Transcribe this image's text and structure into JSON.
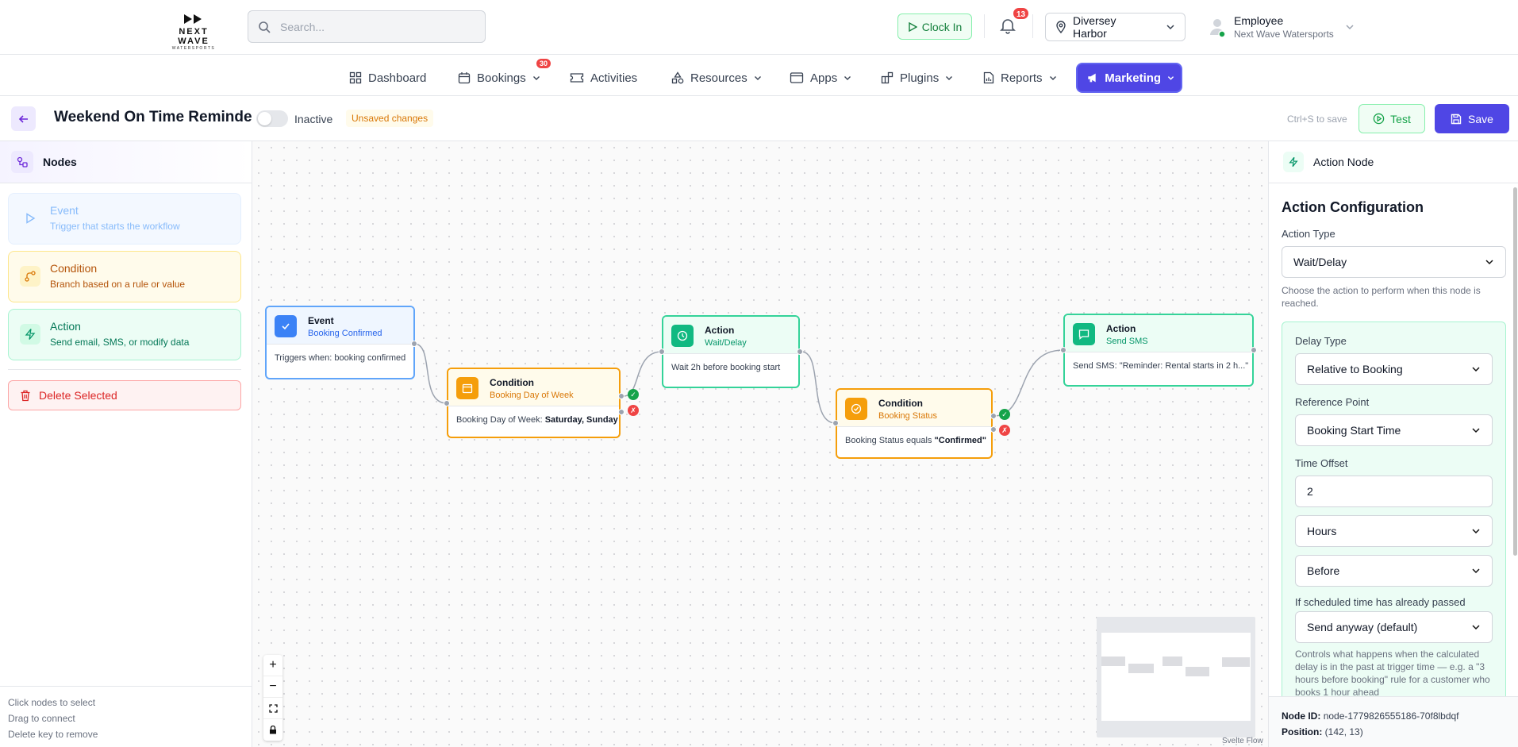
{
  "brand": {
    "name": "NEXT WAVE",
    "tagline": "WATERSPORTS"
  },
  "search": {
    "placeholder": "Search..."
  },
  "header": {
    "clock_in_label": "Clock In",
    "notifications_count": "13",
    "location": "Diversey Harbor",
    "user_role": "Employee",
    "user_org": "Next Wave Watersports"
  },
  "nav": {
    "dashboard": "Dashboard",
    "bookings": "Bookings",
    "bookings_badge": "30",
    "activities": "Activities",
    "resources": "Resources",
    "apps": "Apps",
    "plugins": "Plugins",
    "reports": "Reports",
    "marketing": "Marketing",
    "active_color": "#4f46e5"
  },
  "toolbar": {
    "title": "Weekend On Time Reminde",
    "status": "Inactive",
    "unsaved": "Unsaved changes",
    "hint": "Ctrl+S to save",
    "test_label": "Test",
    "save_label": "Save"
  },
  "left_panel": {
    "title": "Nodes",
    "palette": [
      {
        "title": "Event",
        "desc": "Trigger that starts the workflow"
      },
      {
        "title": "Condition",
        "desc": "Branch based on a rule or value"
      },
      {
        "title": "Action",
        "desc": "Send email, SMS, or modify data"
      }
    ],
    "delete_label": "Delete Selected",
    "tips": [
      "Click nodes to select",
      "Drag to connect",
      "Delete key to remove"
    ]
  },
  "nodes": {
    "event": {
      "title": "Event",
      "subtitle": "Booking Confirmed",
      "body": "Triggers when: booking confirmed"
    },
    "cond1": {
      "title": "Condition",
      "subtitle": "Booking Day of Week",
      "body_prefix": "Booking Day of Week: ",
      "body_value": "Saturday, Sunday"
    },
    "wait": {
      "title": "Action",
      "subtitle": "Wait/Delay",
      "body": "Wait 2h before booking start"
    },
    "cond2": {
      "title": "Condition",
      "subtitle": "Booking Status",
      "body_prefix": "Booking Status equals ",
      "body_value": "\"Confirmed\""
    },
    "sms": {
      "title": "Action",
      "subtitle": "Send SMS",
      "body": "Send SMS: \"Reminder: Rental starts in 2 h...\""
    }
  },
  "attribution": "Svelte Flow",
  "right_panel": {
    "title": "Action Node",
    "section_title": "Action Configuration",
    "action_type_label": "Action Type",
    "action_type_value": "Wait/Delay",
    "action_type_help": "Choose the action to perform when this node is reached.",
    "delay_type_label": "Delay Type",
    "delay_type_value": "Relative to Booking",
    "reference_point_label": "Reference Point",
    "reference_point_value": "Booking Start Time",
    "time_offset_label": "Time Offset",
    "time_offset_value": "2",
    "unit_value": "Hours",
    "direction_value": "Before",
    "passed_label": "If scheduled time has already passed",
    "passed_value": "Send anyway (default)",
    "passed_help": "Controls what happens when the calculated delay is in the past at trigger time — e.g. a \"3 hours before booking\" rule for a customer who books 1 hour ahead",
    "node_id_label": "Node ID:",
    "node_id_value": "node-1779826555186-70f8lbdqf",
    "position_label": "Position:",
    "position_value": "(142, 13)"
  }
}
